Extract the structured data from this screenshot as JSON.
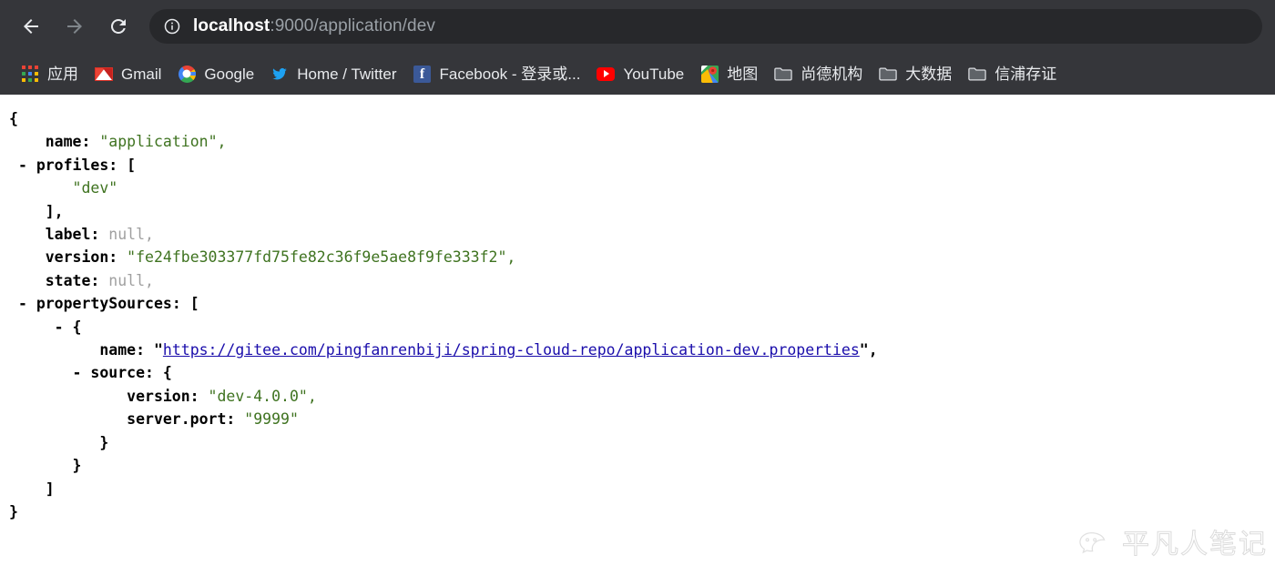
{
  "browser": {
    "nav": {
      "back_label": "Back",
      "forward_label": "Forward",
      "reload_label": "Reload"
    },
    "omnibox": {
      "info_icon": "info-circle-icon",
      "host": "localhost",
      "path": ":9000/application/dev",
      "full_url": "localhost:9000/application/dev"
    },
    "bookmarks": [
      {
        "label": "应用",
        "icon": "apps-grid-icon"
      },
      {
        "label": "Gmail",
        "icon": "gmail-icon"
      },
      {
        "label": "Google",
        "icon": "google-icon"
      },
      {
        "label": "Home / Twitter",
        "icon": "twitter-icon"
      },
      {
        "label": "Facebook - 登录或...",
        "icon": "facebook-icon"
      },
      {
        "label": "YouTube",
        "icon": "youtube-icon"
      },
      {
        "label": "地图",
        "icon": "google-maps-icon"
      },
      {
        "label": "尚德机构",
        "icon": "folder-icon"
      },
      {
        "label": "大数据",
        "icon": "folder-icon"
      },
      {
        "label": "信浦存证",
        "icon": "folder-icon"
      }
    ]
  },
  "json_document": {
    "lines": [
      {
        "indent": 0,
        "toggle": "",
        "key": "",
        "sep": "",
        "value": "{",
        "vtype": "punc"
      },
      {
        "indent": 4,
        "toggle": "",
        "key": "name",
        "sep": ": ",
        "value": "\"application\",",
        "vtype": "str"
      },
      {
        "indent": 1,
        "toggle": "-",
        "key": "profiles",
        "sep": ": ",
        "value": "[",
        "vtype": "punc"
      },
      {
        "indent": 7,
        "toggle": "",
        "key": "",
        "sep": "",
        "value": "\"dev\"",
        "vtype": "str"
      },
      {
        "indent": 4,
        "toggle": "",
        "key": "",
        "sep": "",
        "value": "],",
        "vtype": "punc"
      },
      {
        "indent": 4,
        "toggle": "",
        "key": "label",
        "sep": ": ",
        "value": "null,",
        "vtype": "nul"
      },
      {
        "indent": 4,
        "toggle": "",
        "key": "version",
        "sep": ": ",
        "value": "\"fe24fbe303377fd75fe82c36f9e5ae8f9fe333f2\",",
        "vtype": "str"
      },
      {
        "indent": 4,
        "toggle": "",
        "key": "state",
        "sep": ": ",
        "value": "null,",
        "vtype": "nul"
      },
      {
        "indent": 1,
        "toggle": "-",
        "key": "propertySources",
        "sep": ": ",
        "value": "[",
        "vtype": "punc"
      },
      {
        "indent": 5,
        "toggle": "-",
        "key": "",
        "sep": "",
        "value": "{",
        "vtype": "punc"
      },
      {
        "indent": 10,
        "toggle": "",
        "key": "name",
        "sep": ": ",
        "value": "https://gitee.com/pingfanrenbiji/spring-cloud-repo/application-dev.properties",
        "vtype": "link"
      },
      {
        "indent": 7,
        "toggle": "-",
        "key": "source",
        "sep": ": ",
        "value": "{",
        "vtype": "punc"
      },
      {
        "indent": 13,
        "toggle": "",
        "key": "version",
        "sep": ": ",
        "value": "\"dev-4.0.0\",",
        "vtype": "str"
      },
      {
        "indent": 13,
        "toggle": "",
        "key": "server.port",
        "sep": ": ",
        "value": "\"9999\"",
        "vtype": "str"
      },
      {
        "indent": 10,
        "toggle": "",
        "key": "",
        "sep": "",
        "value": "}",
        "vtype": "punc"
      },
      {
        "indent": 7,
        "toggle": "",
        "key": "",
        "sep": "",
        "value": "}",
        "vtype": "punc"
      },
      {
        "indent": 4,
        "toggle": "",
        "key": "",
        "sep": "",
        "value": "]",
        "vtype": "punc"
      },
      {
        "indent": 0,
        "toggle": "",
        "key": "",
        "sep": "",
        "value": "}",
        "vtype": "punc"
      }
    ]
  },
  "watermark": {
    "text": "平凡人笔记",
    "logo": "wechat-icon"
  },
  "colors": {
    "chrome_toolbar": "#35363a",
    "omnibox_bg": "#27282b",
    "omnibox_text": "#9aa0a6",
    "bookmark_text": "#e8eaed",
    "json_string": "#3f7320",
    "json_null": "#a0a0a0",
    "json_link": "#1a0dab",
    "page_bg": "#ffffff"
  }
}
